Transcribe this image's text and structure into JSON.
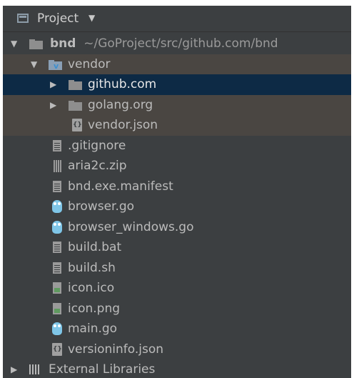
{
  "panel": {
    "title": "Project",
    "caret": "▼"
  },
  "tree": {
    "root": {
      "name": "bnd",
      "path": "~/GoProject/src/github.com/bnd",
      "expanded_glyph": "▼"
    },
    "vendor": {
      "name": "vendor",
      "expanded_glyph": "▼"
    },
    "vendor_children": [
      {
        "name": "github.com",
        "glyph": "▶"
      },
      {
        "name": "golang.org",
        "glyph": "▶"
      },
      {
        "name": "vendor.json"
      }
    ],
    "files": [
      ".gitignore",
      "aria2c.zip",
      "bnd.exe.manifest",
      "browser.go",
      "browser_windows.go",
      "build.bat",
      "build.sh",
      "icon.ico",
      "icon.png",
      "main.go",
      "versioninfo.json"
    ],
    "external": {
      "name": "External Libraries",
      "glyph": "▶"
    }
  },
  "colors": {
    "panel_bg": "#3c3f41",
    "selection": "#0d2a45",
    "vendor_highlight": "#4a4642",
    "go_icon": "#7fc6e8"
  }
}
